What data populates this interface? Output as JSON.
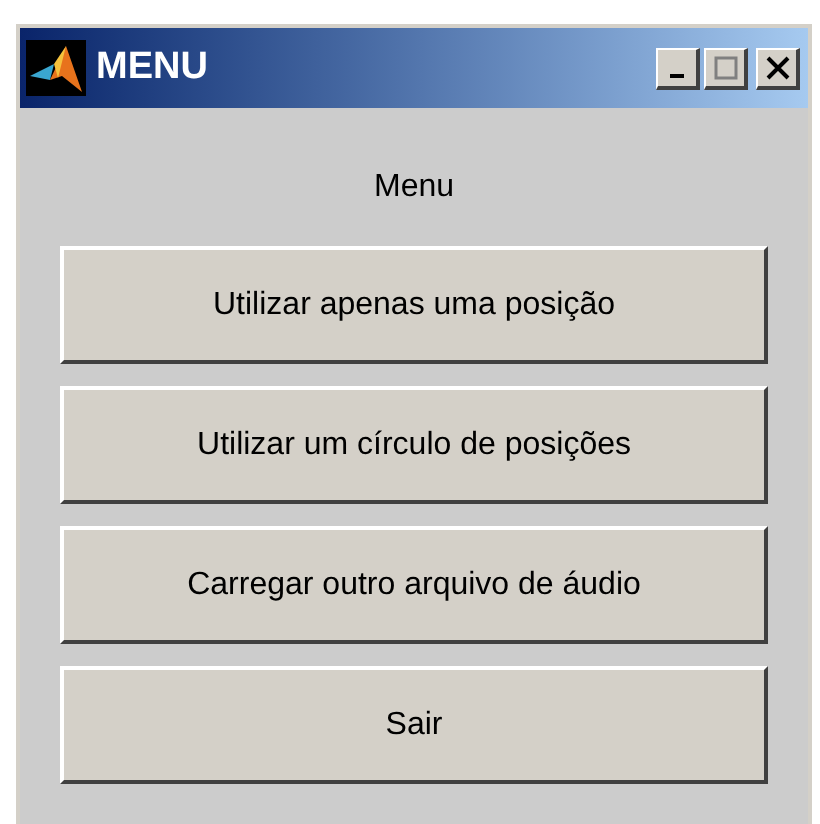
{
  "window": {
    "title": "MENU"
  },
  "heading": "Menu",
  "buttons": [
    "Utilizar apenas uma posição",
    "Utilizar um círculo de posições",
    "Carregar outro arquivo de áudio",
    "Sair"
  ]
}
